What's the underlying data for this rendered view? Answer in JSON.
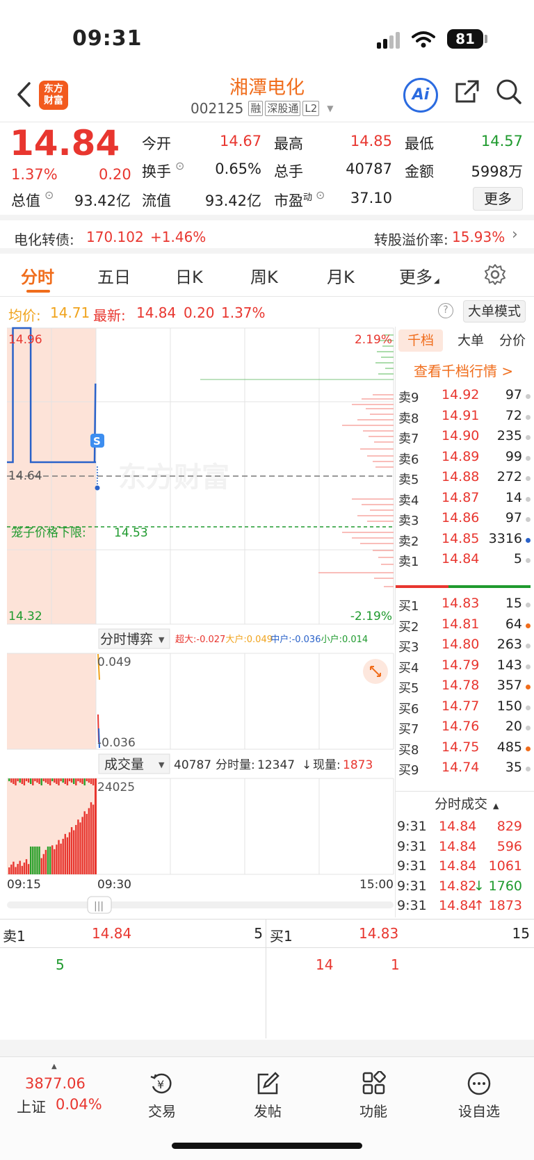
{
  "status": {
    "time": "09:31",
    "battery": "81"
  },
  "header": {
    "logo_line1": "东方",
    "logo_line2": "财富",
    "stock_name": "湘潭电化",
    "code": "002125",
    "tags": [
      "融",
      "深股通",
      "L2"
    ],
    "ai_label": "Ai"
  },
  "quote": {
    "price": "14.84",
    "change_pct": "1.37%",
    "change": "0.20",
    "open_label": "今开",
    "open": "14.67",
    "high_label": "最高",
    "high": "14.85",
    "low_label": "最低",
    "low": "14.57",
    "turnover_label": "换手",
    "turnover": "0.65%",
    "volume_label": "总手",
    "volume": "40787",
    "amount_label": "金额",
    "amount": "5998万",
    "mktcap_label": "总值",
    "mktcap": "93.42亿",
    "float_label": "流值",
    "float": "93.42亿",
    "pe_label": "市盈",
    "pe_sup": "动",
    "pe": "37.10",
    "more": "更多"
  },
  "bond": {
    "name": "电化转债:",
    "price": "170.102",
    "change": "+1.46%",
    "premium_label": "转股溢价率:",
    "premium": "15.93%"
  },
  "tabs": [
    "分时",
    "五日",
    "日K",
    "周K",
    "月K",
    "更多"
  ],
  "info": {
    "avg_label": "均价:",
    "avg": "14.71",
    "last_label": "最新:",
    "last": "14.84",
    "chg": "0.20",
    "pct": "1.37%",
    "mode_btn": "大单模式"
  },
  "chart": {
    "watermark": "东方财富",
    "y_top": "14.96",
    "y_mid": "14.64",
    "y_bottom": "14.32",
    "pct_top": "2.19%",
    "pct_bottom": "-2.19%",
    "cage_label": "笼子价格下限:",
    "cage_value": "14.53",
    "s_marker": "S",
    "game_title": "分时博弈",
    "game_legend": [
      {
        "label": "超大:-0.027",
        "color": "#e8362f"
      },
      {
        "label": "大户:0.049",
        "color": "#f0a31c"
      },
      {
        "label": "中户:-0.036",
        "color": "#2a62c9"
      },
      {
        "label": "小户:0.014",
        "color": "#1f9a2e"
      }
    ],
    "game_top": "0.049",
    "game_bottom": "-0.036",
    "vol_title": "成交量",
    "vol_total": "40787",
    "vol_period_label": "分时量:",
    "vol_period": "12347",
    "vol_now_label": "现量:",
    "vol_now": "1873",
    "vol_max": "24025",
    "x_start": "09:15",
    "x_mid": "09:30",
    "x_end": "15:00"
  },
  "chart_data": {
    "type": "line",
    "title": "",
    "x_labels": [
      "09:15",
      "09:30",
      "15:00"
    ],
    "ylim": [
      14.32,
      14.96
    ],
    "prev_close": 14.64,
    "cage_lower": 14.53,
    "auction_price": [
      {
        "t": "09:15",
        "v": 14.67
      },
      {
        "t": "09:16",
        "v": 14.96
      },
      {
        "t": "09:18",
        "v": 14.96
      },
      {
        "t": "09:19",
        "v": 14.67
      },
      {
        "t": "09:25",
        "v": 14.67
      },
      {
        "t": "09:30",
        "v": 14.67
      }
    ],
    "trade_price": [
      {
        "t": "09:30",
        "v": 14.67
      },
      {
        "t": "09:31",
        "v": 14.84
      }
    ],
    "volume_max": 24025
  },
  "book": {
    "tabs": [
      "千档",
      "大单",
      "分价"
    ],
    "link": "查看千档行情 >",
    "asks": [
      {
        "label": "卖9",
        "price": "14.92",
        "vol": "97",
        "dot": "#ccc"
      },
      {
        "label": "卖8",
        "price": "14.91",
        "vol": "72",
        "dot": "#ccc"
      },
      {
        "label": "卖7",
        "price": "14.90",
        "vol": "235",
        "dot": "#ccc"
      },
      {
        "label": "卖6",
        "price": "14.89",
        "vol": "99",
        "dot": "#ccc"
      },
      {
        "label": "卖5",
        "price": "14.88",
        "vol": "272",
        "dot": "#ccc"
      },
      {
        "label": "卖4",
        "price": "14.87",
        "vol": "14",
        "dot": "#ccc"
      },
      {
        "label": "卖3",
        "price": "14.86",
        "vol": "97",
        "dot": "#ccc"
      },
      {
        "label": "卖2",
        "price": "14.85",
        "vol": "3316",
        "dot": "#2a62c9"
      },
      {
        "label": "卖1",
        "price": "14.84",
        "vol": "5",
        "dot": "#ccc"
      }
    ],
    "bids": [
      {
        "label": "买1",
        "price": "14.83",
        "vol": "15",
        "dot": "#ccc"
      },
      {
        "label": "买2",
        "price": "14.81",
        "vol": "64",
        "dot": "#f06d1c"
      },
      {
        "label": "买3",
        "price": "14.80",
        "vol": "263",
        "dot": "#ccc"
      },
      {
        "label": "买4",
        "price": "14.79",
        "vol": "143",
        "dot": "#ccc"
      },
      {
        "label": "买5",
        "price": "14.78",
        "vol": "357",
        "dot": "#f06d1c"
      },
      {
        "label": "买6",
        "price": "14.77",
        "vol": "150",
        "dot": "#ccc"
      },
      {
        "label": "买7",
        "price": "14.76",
        "vol": "20",
        "dot": "#ccc"
      },
      {
        "label": "买8",
        "price": "14.75",
        "vol": "485",
        "dot": "#f06d1c"
      },
      {
        "label": "买9",
        "price": "14.74",
        "vol": "35",
        "dot": "#ccc"
      }
    ],
    "ticks_title": "分时成交",
    "ticks": [
      {
        "time": "9:31",
        "price": "14.84",
        "vol": "829",
        "dir": "",
        "vcolor": "#e8362f"
      },
      {
        "time": "9:31",
        "price": "14.84",
        "vol": "596",
        "dir": "",
        "vcolor": "#e8362f"
      },
      {
        "time": "9:31",
        "price": "14.84",
        "vol": "1061",
        "dir": "",
        "vcolor": "#e8362f"
      },
      {
        "time": "9:31",
        "price": "14.82",
        "vol": "1760",
        "dir": "↓",
        "vcolor": "#1f9a2e"
      },
      {
        "time": "9:31",
        "price": "14.84",
        "vol": "1873",
        "dir": "↑",
        "vcolor": "#e8362f"
      }
    ]
  },
  "best": {
    "ask_label": "卖1",
    "ask_price": "14.84",
    "ask_vol": "5",
    "bid_label": "买1",
    "bid_price": "14.83",
    "bid_vol": "15",
    "ask_queue": [
      "5"
    ],
    "bid_queue": [
      "14",
      "1"
    ]
  },
  "nav": {
    "index_value": "3877.06",
    "index_name": "上证",
    "index_pct": "0.04%",
    "items": [
      "交易",
      "发帖",
      "功能",
      "设自选"
    ]
  }
}
